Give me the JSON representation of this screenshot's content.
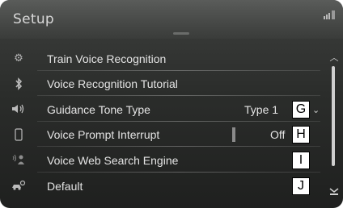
{
  "header": {
    "title": "Setup"
  },
  "rows": [
    {
      "label": "Train Voice Recognition",
      "icon": "gear-icon"
    },
    {
      "label": "Voice Recognition Tutorial",
      "icon": "bluetooth-icon"
    },
    {
      "label": "Guidance Tone Type",
      "icon": "speaker-icon",
      "value": "Type 1",
      "callout": "G"
    },
    {
      "label": "Voice Prompt Interrupt",
      "icon": "phone-icon",
      "value": "Off",
      "callout": "H"
    },
    {
      "label": "Voice Web Search Engine",
      "icon": "voice-icon",
      "callout": "I"
    },
    {
      "label": "Default",
      "icon": "car-key-icon",
      "callout": "J"
    }
  ]
}
